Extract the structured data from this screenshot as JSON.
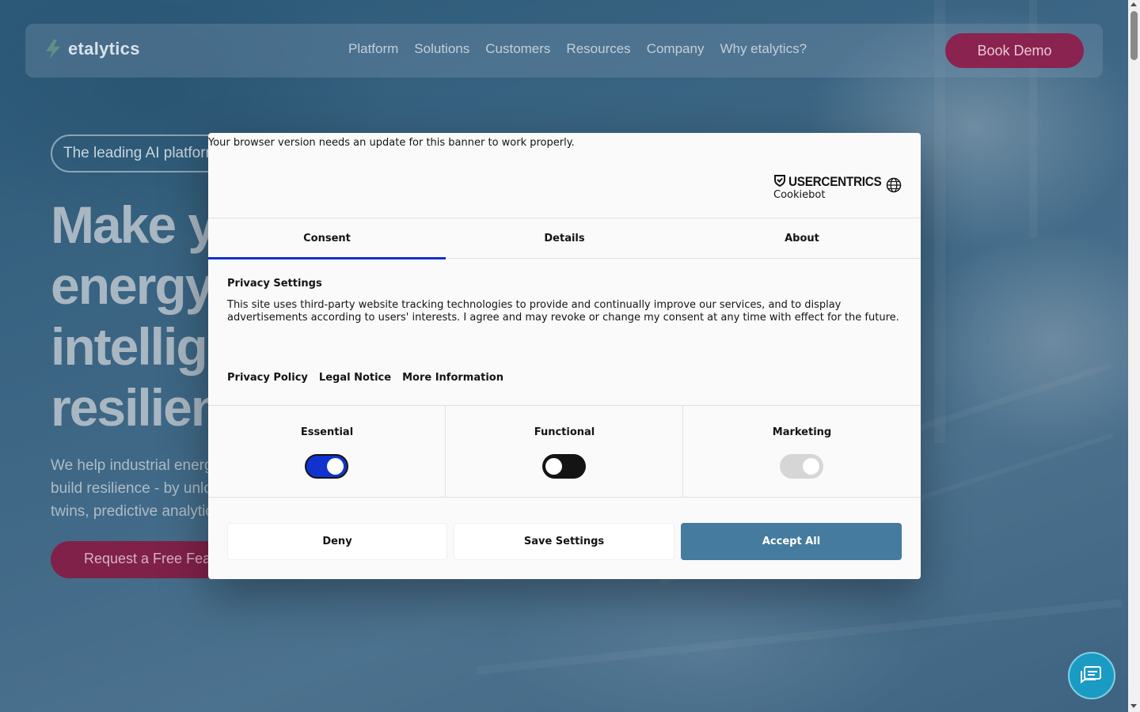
{
  "site": {
    "logo_text": "etalytics",
    "nav_items": [
      "Platform",
      "Solutions",
      "Customers",
      "Resources",
      "Company",
      "Why etalytics?"
    ],
    "book_demo_label": "Book Demo"
  },
  "hero": {
    "pill_text": "The leading AI platform",
    "headline_lines": [
      "Make y",
      "energy",
      "intellig",
      "resilien"
    ],
    "subtext_lines": [
      "We help industrial energ",
      "build resilience - by unlo",
      "twins, predictive analytic"
    ],
    "cta_label": "Request a Free Feas"
  },
  "cookie_dialog": {
    "browser_note": "Your browser version needs an update for this banner to work properly.",
    "brand_name": "USERCENTRICS",
    "brand_sub": "Cookiebot",
    "language_icon": "globe-icon",
    "tabs": [
      "Consent",
      "Details",
      "About"
    ],
    "active_tab": "Consent",
    "privacy_title": "Privacy Settings",
    "privacy_text": "This site uses third-party website tracking technologies to provide and continually improve our services, and to display advertisements according to users' interests. I agree and may revoke or change my consent at any time with effect for the future.",
    "links": [
      "Privacy Policy",
      "Legal Notice",
      "More Information"
    ],
    "categories": [
      {
        "label": "Essential",
        "state": "on-disabled"
      },
      {
        "label": "Functional",
        "state": "off"
      },
      {
        "label": "Marketing",
        "state": "disabled"
      }
    ],
    "buttons": {
      "deny": "Deny",
      "save": "Save Settings",
      "accept": "Accept All"
    }
  },
  "colors": {
    "accent_blue": "#1032cf",
    "accept_button": "#447b9e",
    "brand_magenta": "#8a2350",
    "chat_button": "#1a9bc4"
  },
  "chat_icon": "chat-icon"
}
